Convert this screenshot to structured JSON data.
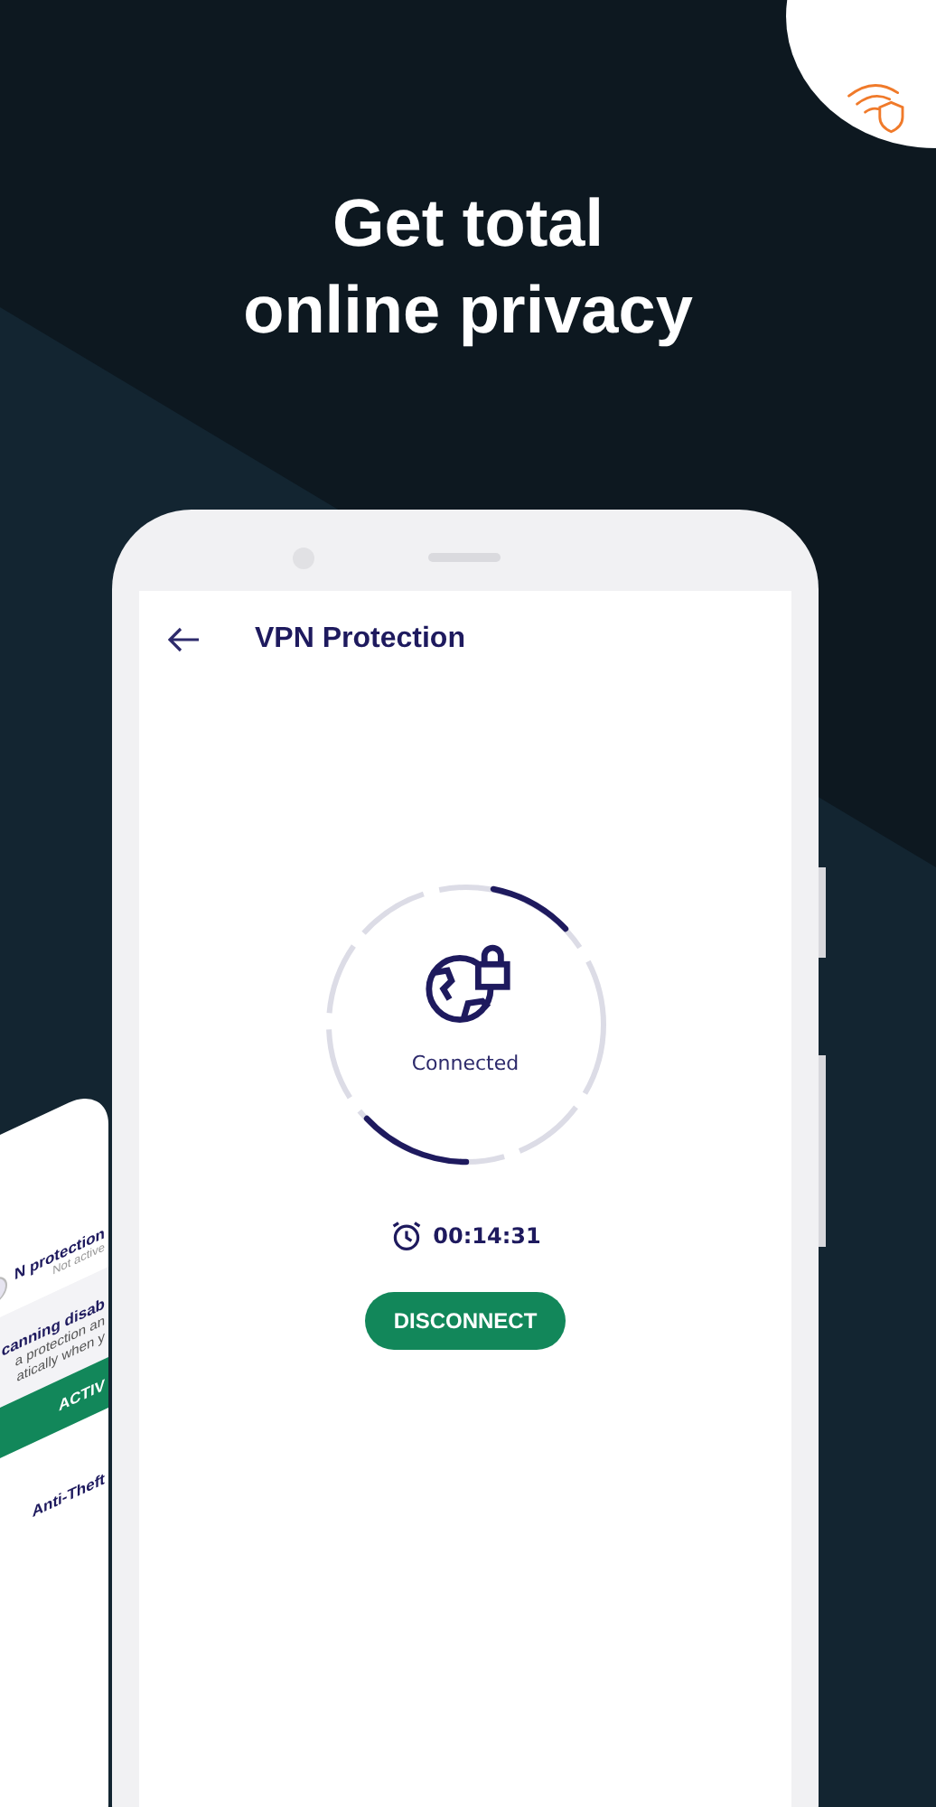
{
  "headline": "Get total\nonline privacy",
  "back_phone": {
    "vpn_title": "N protection",
    "vpn_status": "Not active",
    "warning_title": "canning disab",
    "warning_lines": [
      "a protection an",
      "atically when y"
    ],
    "button": "ACTIV",
    "anti_theft": "Anti-Theft"
  },
  "screen": {
    "title": "VPN Protection",
    "status": "Connected",
    "timer": "00:14:31",
    "button": "DISCONNECT"
  }
}
